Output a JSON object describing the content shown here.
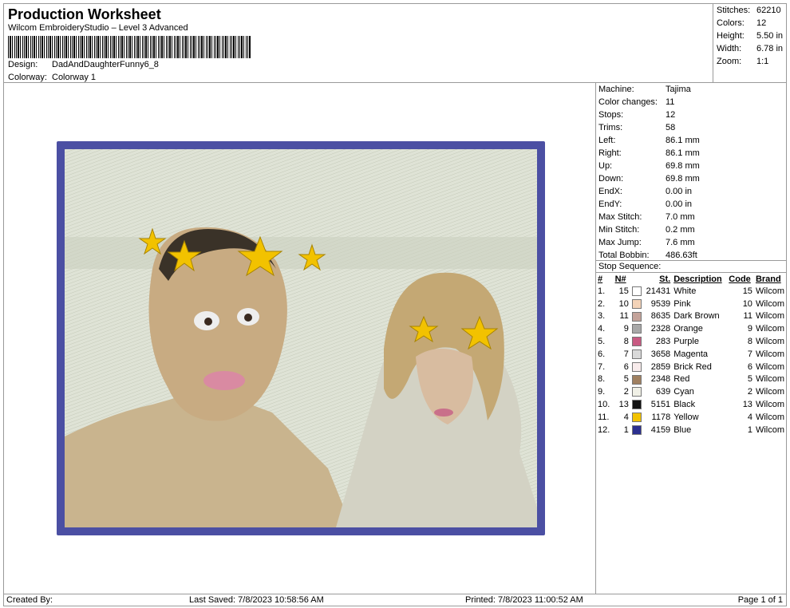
{
  "header": {
    "title": "Production Worksheet",
    "subtitle": "Wilcom EmbroideryStudio – Level 3 Advanced",
    "design_label": "Design:",
    "design_value": "DadAndDaughterFunny6_8",
    "colorway_label": "Colorway:",
    "colorway_value": "Colorway 1"
  },
  "summary": {
    "stitches_label": "Stitches:",
    "stitches": "62210",
    "colors_label": "Colors:",
    "colors": "12",
    "height_label": "Height:",
    "height": "5.50 in",
    "width_label": "Width:",
    "width": "6.78 in",
    "zoom_label": "Zoom:",
    "zoom": "1:1"
  },
  "machine": {
    "items": [
      {
        "label": "Machine:",
        "value": "Tajima"
      },
      {
        "label": "Color changes:",
        "value": "11"
      },
      {
        "label": "Stops:",
        "value": "12"
      },
      {
        "label": "Trims:",
        "value": "58"
      },
      {
        "label": "Left:",
        "value": "86.1 mm"
      },
      {
        "label": "Right:",
        "value": "86.1 mm"
      },
      {
        "label": "Up:",
        "value": "69.8 mm"
      },
      {
        "label": "Down:",
        "value": "69.8 mm"
      },
      {
        "label": "EndX:",
        "value": "0.00 in"
      },
      {
        "label": "EndY:",
        "value": "0.00 in"
      },
      {
        "label": "Max Stitch:",
        "value": "7.0 mm"
      },
      {
        "label": "Min Stitch:",
        "value": "0.2 mm"
      },
      {
        "label": "Max Jump:",
        "value": "7.6 mm"
      },
      {
        "label": "Total Bobbin:",
        "value": "486.63ft"
      }
    ]
  },
  "stop_sequence": {
    "title": "Stop Sequence:",
    "headers": {
      "num": "#",
      "n": "N#",
      "st": "St.",
      "desc": "Description",
      "code": "Code",
      "brand": "Brand"
    },
    "rows": [
      {
        "num": "1.",
        "n": "15",
        "color": "#ffffff",
        "st": "21431",
        "desc": "White",
        "code": "15",
        "brand": "Wilcom"
      },
      {
        "num": "2.",
        "n": "10",
        "color": "#f3d3b8",
        "st": "9539",
        "desc": "Pink",
        "code": "10",
        "brand": "Wilcom"
      },
      {
        "num": "3.",
        "n": "11",
        "color": "#c4a39a",
        "st": "8635",
        "desc": "Dark Brown",
        "code": "11",
        "brand": "Wilcom"
      },
      {
        "num": "4.",
        "n": "9",
        "color": "#a8a8a8",
        "st": "2328",
        "desc": "Orange",
        "code": "9",
        "brand": "Wilcom"
      },
      {
        "num": "5.",
        "n": "8",
        "color": "#c85a82",
        "st": "283",
        "desc": "Purple",
        "code": "8",
        "brand": "Wilcom"
      },
      {
        "num": "6.",
        "n": "7",
        "color": "#d9d9d9",
        "st": "3658",
        "desc": "Magenta",
        "code": "7",
        "brand": "Wilcom"
      },
      {
        "num": "7.",
        "n": "6",
        "color": "#f8ecec",
        "st": "2859",
        "desc": "Brick Red",
        "code": "6",
        "brand": "Wilcom"
      },
      {
        "num": "8.",
        "n": "5",
        "color": "#a08060",
        "st": "2348",
        "desc": "Red",
        "code": "5",
        "brand": "Wilcom"
      },
      {
        "num": "9.",
        "n": "2",
        "color": "#f0f0e6",
        "st": "639",
        "desc": "Cyan",
        "code": "2",
        "brand": "Wilcom"
      },
      {
        "num": "10.",
        "n": "13",
        "color": "#111111",
        "st": "5151",
        "desc": "Black",
        "code": "13",
        "brand": "Wilcom"
      },
      {
        "num": "11.",
        "n": "4",
        "color": "#f2c200",
        "st": "1178",
        "desc": "Yellow",
        "code": "4",
        "brand": "Wilcom"
      },
      {
        "num": "12.",
        "n": "1",
        "color": "#2b2f8f",
        "st": "4159",
        "desc": "Blue",
        "code": "1",
        "brand": "Wilcom"
      }
    ]
  },
  "footer": {
    "created_by": "Created By:",
    "last_saved": "Last Saved: 7/8/2023 10:58:56 AM",
    "printed": "Printed: 7/8/2023 11:00:52 AM",
    "page": "Page 1 of 1"
  },
  "colors": {
    "border": "#9a9a9a",
    "hoop_frame": "#4b4fa3",
    "star": "#f2c200"
  }
}
